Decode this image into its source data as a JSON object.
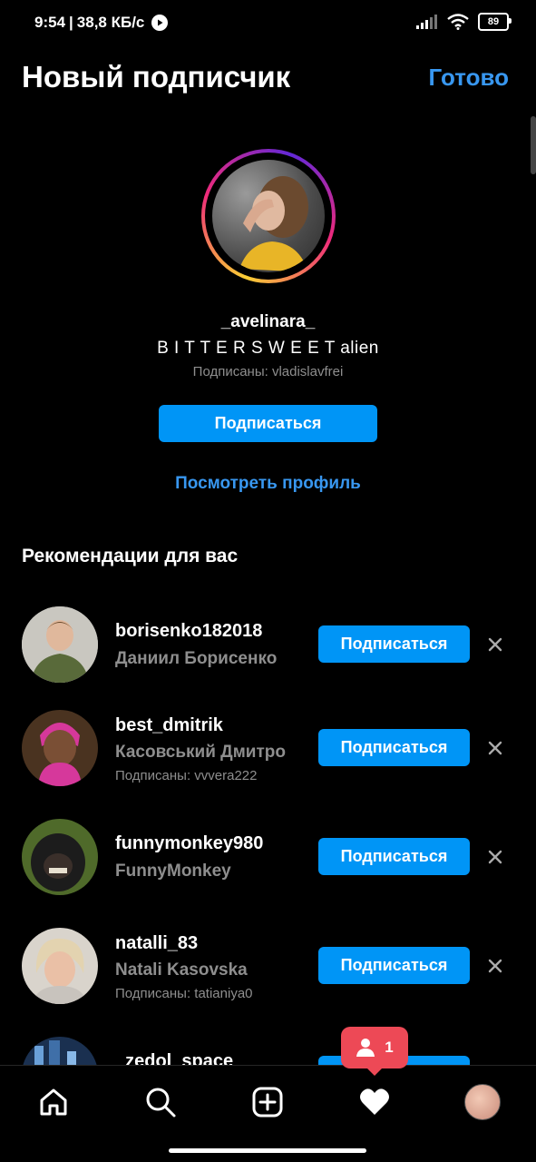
{
  "status_bar": {
    "time": "9:54",
    "speed": "38,8 КБ/с",
    "battery": "89"
  },
  "header": {
    "title": "Новый подписчик",
    "done_label": "Готово"
  },
  "profile": {
    "username": "_avelinara_",
    "bio": "B I T T E R S W E E T alien",
    "followed_by": "Подписаны: vladislavfrei",
    "follow_label": "Подписаться",
    "view_profile_label": "Посмотреть профиль"
  },
  "suggestions": {
    "title": "Рекомендации для вас",
    "items": [
      {
        "username": "borisenko182018",
        "name": "Даниил Борисенко",
        "followed_by": "",
        "button": "Подписаться"
      },
      {
        "username": "best_dmitrik",
        "name": "Касовський Дмитро",
        "followed_by": "Подписаны: vvvera222",
        "button": "Подписаться"
      },
      {
        "username": "funnymonkey980",
        "name": "FunnyMonkey",
        "followed_by": "",
        "button": "Подписаться"
      },
      {
        "username": "natalli_83",
        "name": "Natali Kasovska",
        "followed_by": "Подписаны: tatianiya0",
        "button": "Подписаться"
      },
      {
        "username": "_zedol_space",
        "name": "",
        "followed_by": "",
        "button": "Подписаться"
      }
    ]
  },
  "notification": {
    "count": "1"
  },
  "colors": {
    "accent": "#0095f6",
    "link": "#3897f0",
    "secondary_text": "#8e8e8e",
    "notification": "#ed4956"
  },
  "nav": {
    "icons": [
      "home-icon",
      "search-icon",
      "add-post-icon",
      "heart-icon",
      "profile-avatar"
    ]
  }
}
